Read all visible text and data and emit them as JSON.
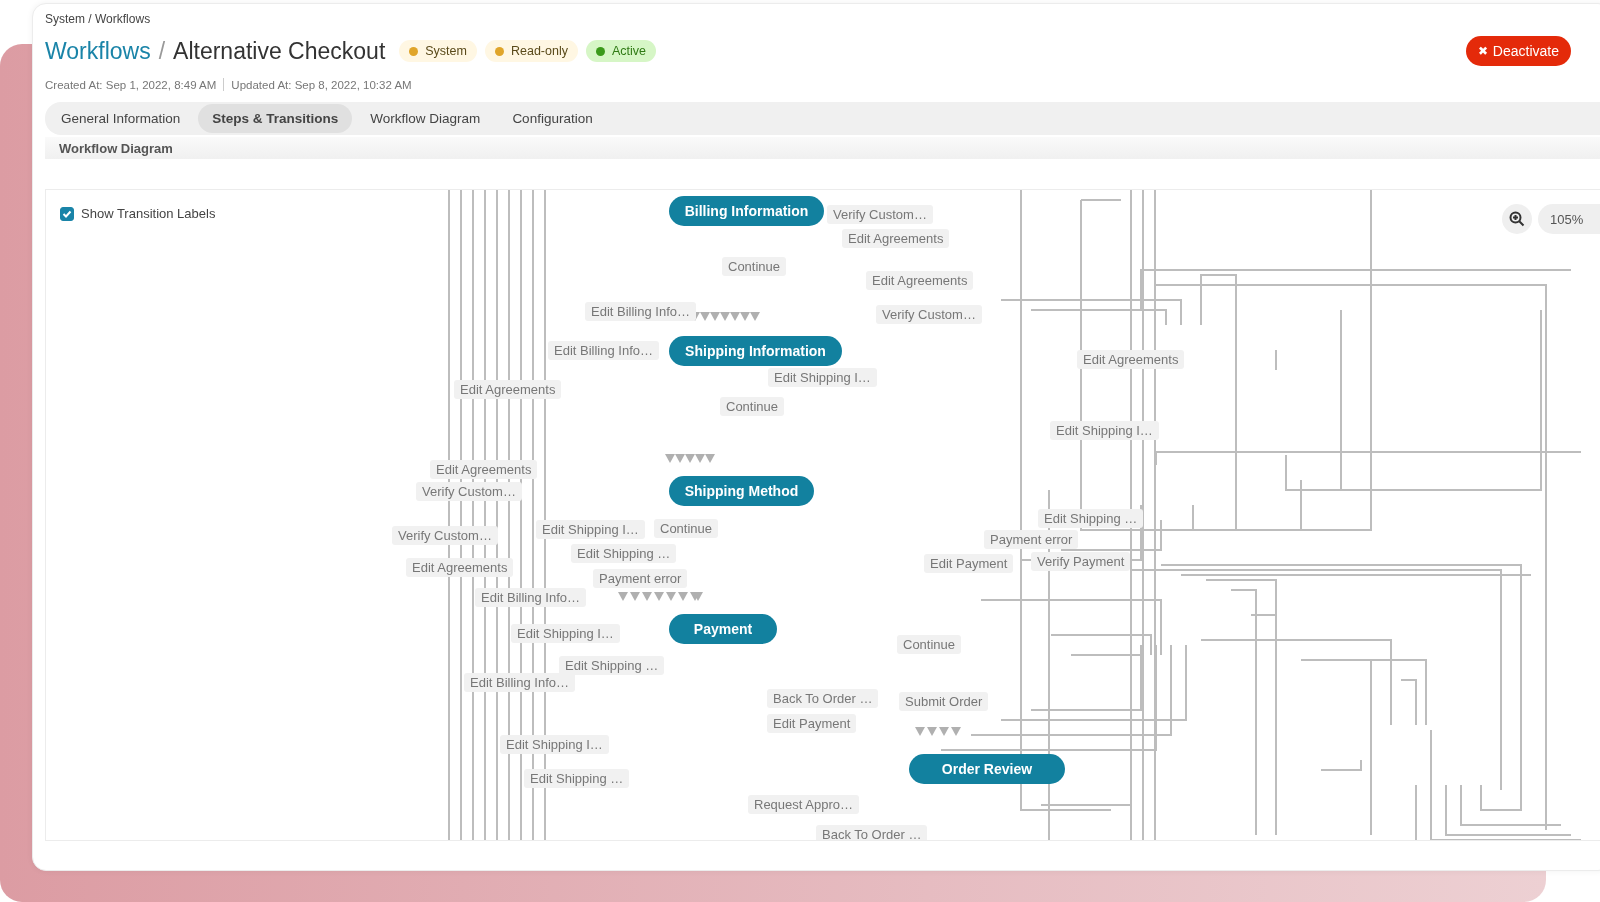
{
  "breadcrumb": "System / Workflows",
  "title": {
    "section": "Workflows",
    "separator": "/",
    "name": "Alternative Checkout"
  },
  "badges": [
    {
      "label": "System",
      "color": "#e0a52a"
    },
    {
      "label": "Read-only",
      "color": "#e0a52a"
    },
    {
      "label": "Active",
      "color": "#3a9a1a"
    }
  ],
  "deactivate_button": {
    "icon": "✖",
    "label": "Deactivate"
  },
  "meta": {
    "created": "Created At: Sep 1, 2022, 8:49 AM",
    "updated": "Updated At: Sep 8, 2022, 10:32 AM"
  },
  "tabs": [
    {
      "label": "General Information",
      "selected": false
    },
    {
      "label": "Steps & Transitions",
      "selected": true
    },
    {
      "label": "Workflow Diagram",
      "selected": false
    },
    {
      "label": "Configuration",
      "selected": false
    }
  ],
  "section_title": "Workflow Diagram",
  "show_transition_labels": {
    "label": "Show Transition Labels",
    "checked": true
  },
  "zoom": {
    "value": "105%"
  },
  "nodes": [
    {
      "label": "Billing Information"
    },
    {
      "label": "Shipping Information"
    },
    {
      "label": "Shipping Method"
    },
    {
      "label": "Payment"
    },
    {
      "label": "Order Review"
    }
  ],
  "transition_labels": [
    {
      "label": "Verify Custom…"
    },
    {
      "label": "Edit Agreements"
    },
    {
      "label": "Continue"
    },
    {
      "label": "Edit Agreements"
    },
    {
      "label": "Edit Billing Info…"
    },
    {
      "label": "Verify Custom…"
    },
    {
      "label": "Edit Billing Info…"
    },
    {
      "label": "Edit Shipping I…"
    },
    {
      "label": "Edit Agreements"
    },
    {
      "label": "Edit Agreements"
    },
    {
      "label": "Continue"
    },
    {
      "label": "Edit Shipping I…"
    },
    {
      "label": "Edit Agreements"
    },
    {
      "label": "Verify Custom…"
    },
    {
      "label": "Edit Shipping I…"
    },
    {
      "label": "Continue"
    },
    {
      "label": "Verify Custom…"
    },
    {
      "label": "Edit Shipping …"
    },
    {
      "label": "Edit Agreements"
    },
    {
      "label": "Payment error"
    },
    {
      "label": "Edit Billing Info…"
    },
    {
      "label": "Edit Shipping …"
    },
    {
      "label": "Verify Payment"
    },
    {
      "label": "Payment error"
    },
    {
      "label": "Edit Payment"
    },
    {
      "label": "Edit Shipping I…"
    },
    {
      "label": "Continue"
    },
    {
      "label": "Edit Shipping …"
    },
    {
      "label": "Edit Billing Info…"
    },
    {
      "label": "Back To Order …"
    },
    {
      "label": "Submit Order"
    },
    {
      "label": "Edit Payment"
    },
    {
      "label": "Edit Shipping I…"
    },
    {
      "label": "Edit Shipping …"
    },
    {
      "label": "Request Appro…"
    },
    {
      "label": "Back To Order …"
    }
  ]
}
